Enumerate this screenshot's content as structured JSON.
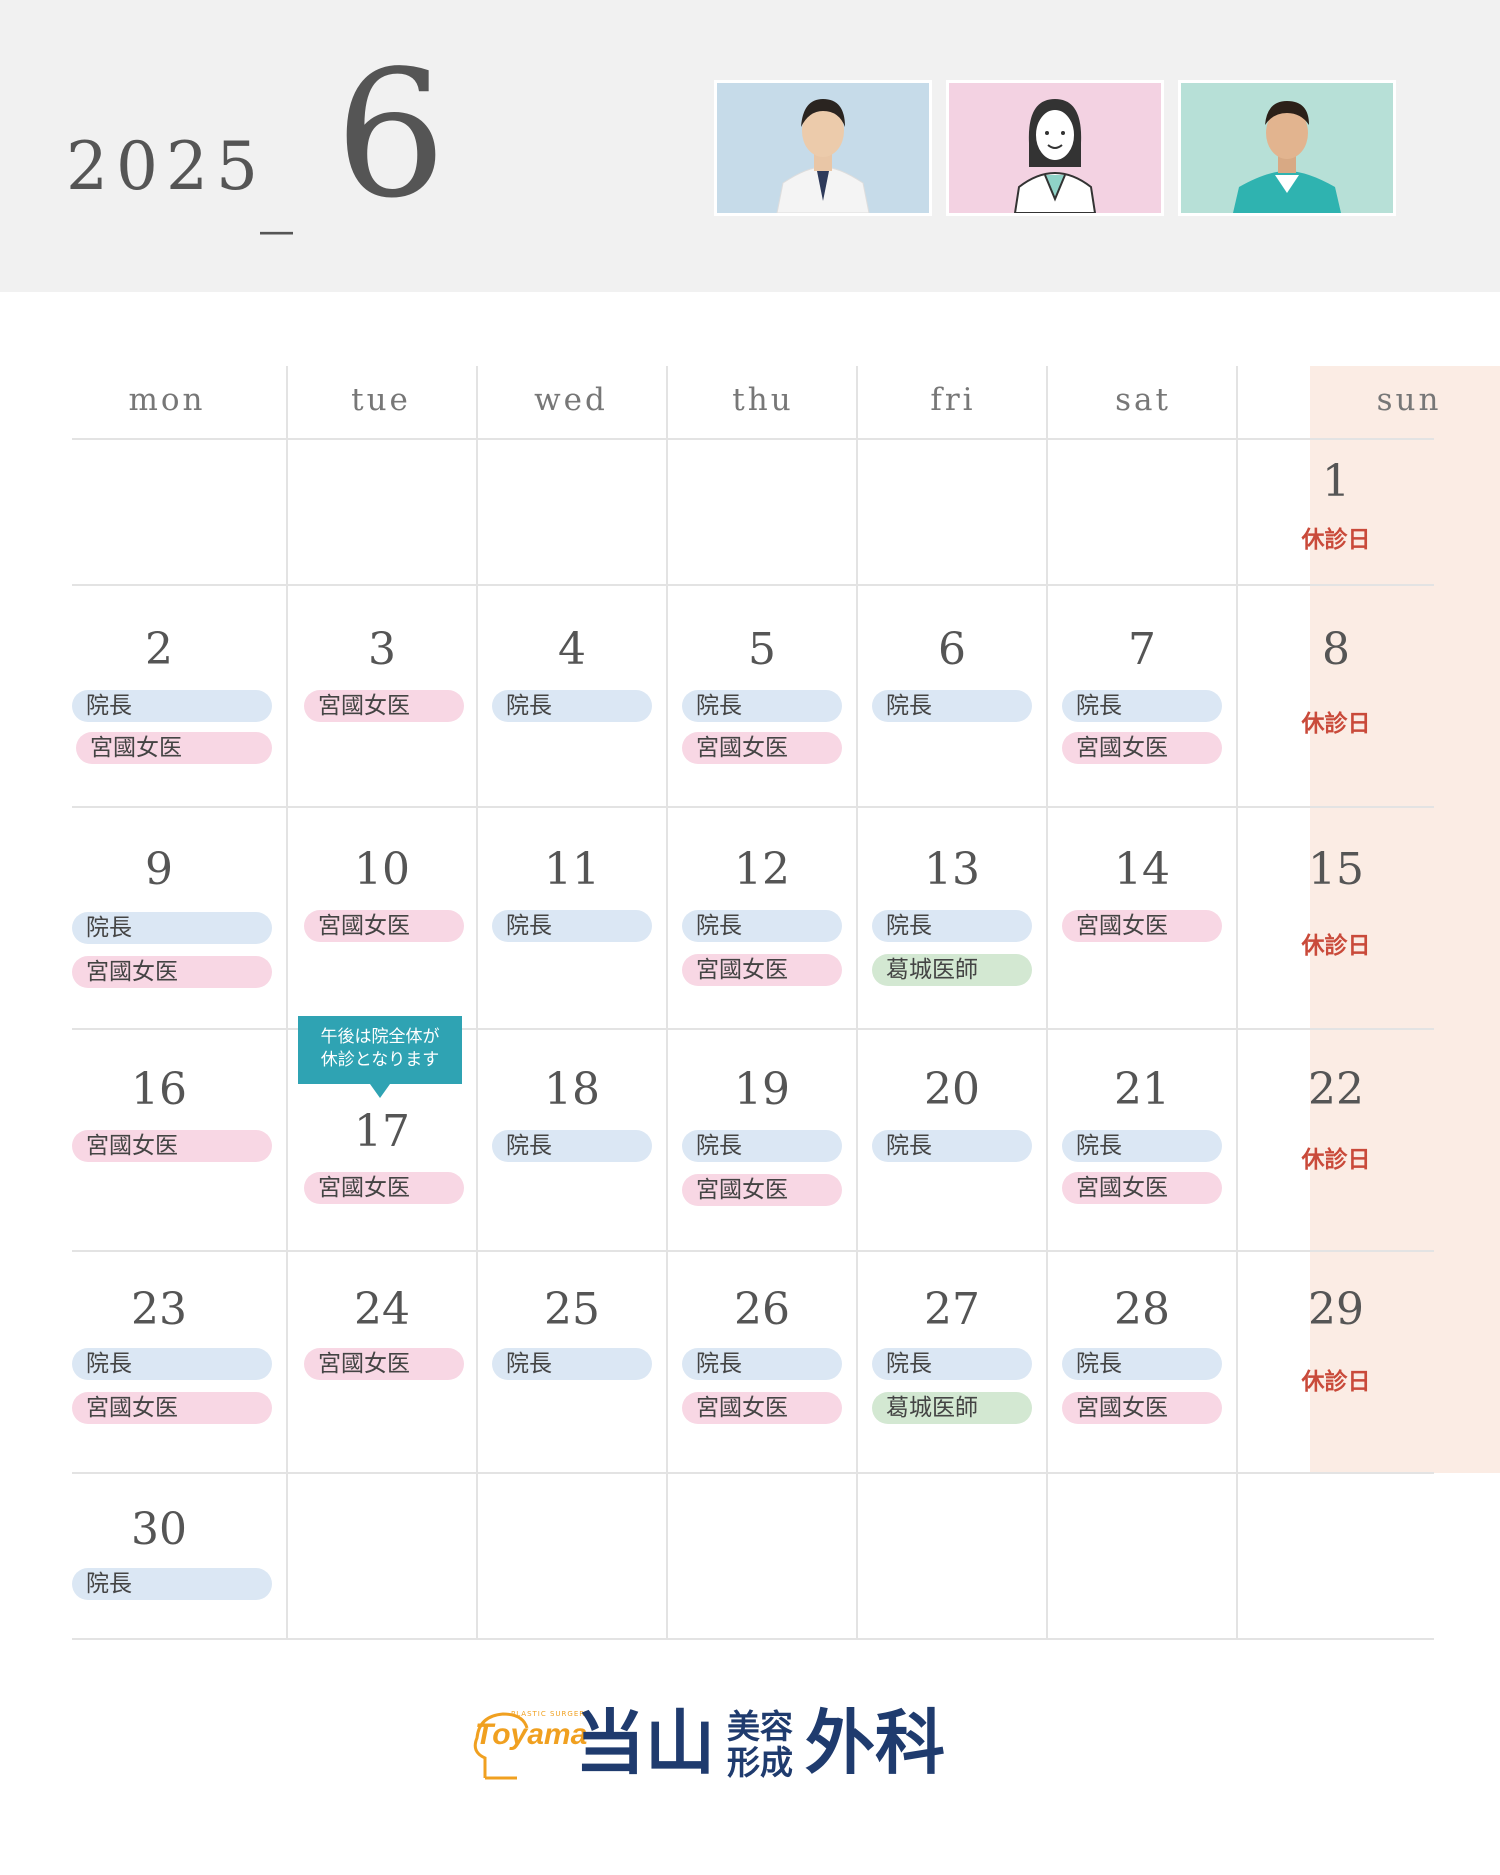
{
  "header": {
    "year": "2025",
    "separator": "_",
    "month": "6"
  },
  "doctors": [
    {
      "name": "院長",
      "color": "#dbe7f4",
      "portrait_bg": "#c6dbe9"
    },
    {
      "name": "宮國女医",
      "color": "#f8d7e4",
      "portrait_bg": "#f3d2e2"
    },
    {
      "name": "葛城医師",
      "color": "#d3e8d2",
      "portrait_bg": "#b7e0d7"
    }
  ],
  "weekdays": [
    "mon",
    "tue",
    "wed",
    "thu",
    "fri",
    "sat",
    "sun"
  ],
  "closed_label": "休診日",
  "days": {
    "d1": "1",
    "d2": "2",
    "d3": "3",
    "d4": "4",
    "d5": "5",
    "d6": "6",
    "d7": "7",
    "d8": "8",
    "d9": "9",
    "d10": "10",
    "d11": "11",
    "d12": "12",
    "d13": "13",
    "d14": "14",
    "d15": "15",
    "d16": "16",
    "d17": "17",
    "d18": "18",
    "d19": "19",
    "d20": "20",
    "d21": "21",
    "d22": "22",
    "d23": "23",
    "d24": "24",
    "d25": "25",
    "d26": "26",
    "d27": "27",
    "d28": "28",
    "d29": "29",
    "d30": "30"
  },
  "schedule": {
    "d2": [
      "院長",
      "宮國女医"
    ],
    "d3": [
      "宮國女医"
    ],
    "d4": [
      "院長"
    ],
    "d5": [
      "院長",
      "宮國女医"
    ],
    "d6": [
      "院長"
    ],
    "d7": [
      "院長",
      "宮國女医"
    ],
    "d9": [
      "院長",
      "宮國女医"
    ],
    "d10": [
      "宮國女医"
    ],
    "d11": [
      "院長"
    ],
    "d12": [
      "院長",
      "宮國女医"
    ],
    "d13": [
      "院長",
      "葛城医師"
    ],
    "d14": [
      "宮國女医"
    ],
    "d16": [
      "宮國女医"
    ],
    "d17": [
      "宮國女医"
    ],
    "d18": [
      "院長"
    ],
    "d19": [
      "院長",
      "宮國女医"
    ],
    "d20": [
      "院長"
    ],
    "d21": [
      "院長",
      "宮國女医"
    ],
    "d23": [
      "院長",
      "宮國女医"
    ],
    "d24": [
      "宮國女医"
    ],
    "d25": [
      "院長"
    ],
    "d26": [
      "院長",
      "宮國女医"
    ],
    "d27": [
      "院長",
      "葛城医師"
    ],
    "d28": [
      "院長",
      "宮國女医"
    ],
    "d30": [
      "院長"
    ]
  },
  "note": {
    "line1": "午後は院全体が",
    "line2": "休診となります"
  },
  "footer": {
    "brand_small": "PLASTIC SURGERY",
    "brand_script": "Toyama",
    "name_part1": "当山",
    "name_part2a": "美容",
    "name_part2b": "形成",
    "name_part3": "外科"
  }
}
